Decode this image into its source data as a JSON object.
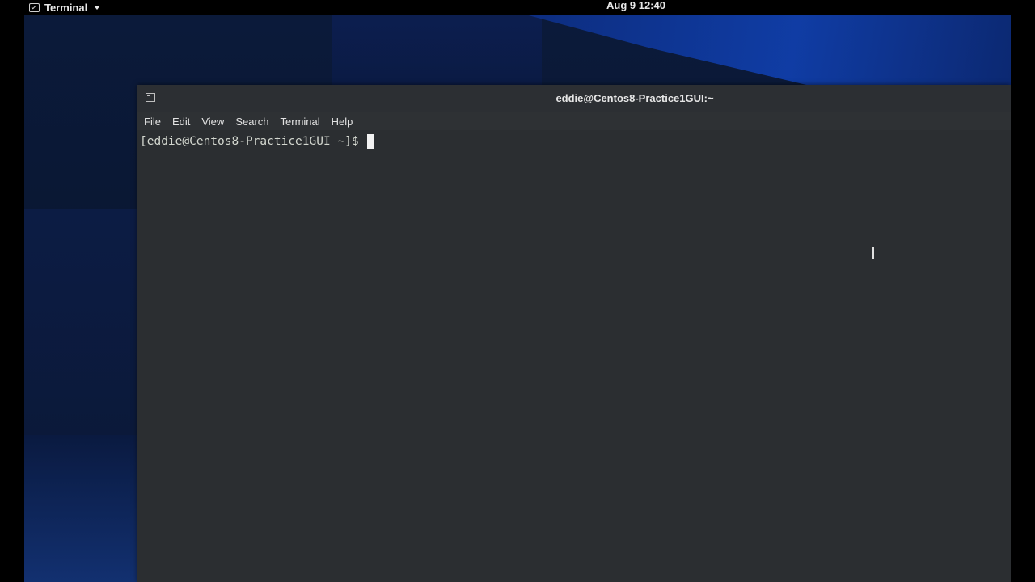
{
  "topbar": {
    "app_name": "Terminal",
    "app_icon": "terminal-icon",
    "clock": "Aug 9  12:40"
  },
  "window": {
    "title": "eddie@Centos8-Practice1GUI:~",
    "title_icon": "terminal-icon",
    "menu": [
      "File",
      "Edit",
      "View",
      "Search",
      "Terminal",
      "Help"
    ]
  },
  "terminal": {
    "prompt": "[eddie@Centos8-Practice1GUI ~]$ "
  },
  "colors": {
    "terminal_bg": "#2b2e31",
    "terminal_fg": "#d3d7cf",
    "topbar_bg": "#000000",
    "wallpaper_accent": "#1040b0"
  }
}
